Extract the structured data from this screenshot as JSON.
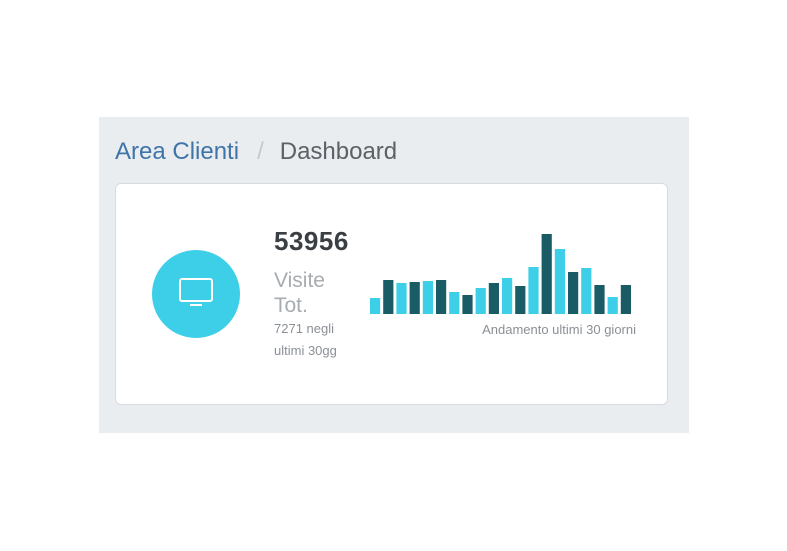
{
  "breadcrumb": {
    "parent": "Area Clienti",
    "separator": "/",
    "current": "Dashboard"
  },
  "stat_card": {
    "icon": "monitor-icon",
    "value": "53956",
    "label": "Visite Tot.",
    "sub_label": "7271 negli ultimi 30gg",
    "chart_caption": "Andamento ultimi 30 giorni"
  },
  "colors": {
    "accent_light": "#3ecfe8",
    "accent_dark": "#1a5c66",
    "link": "#3f74a8",
    "panel_bg": "#e9edf0"
  },
  "chart_data": {
    "type": "bar",
    "title": "",
    "xlabel": "",
    "ylabel": "",
    "ylim": [
      0,
      80
    ],
    "grid": false,
    "values": [
      16,
      34,
      31,
      32,
      33,
      34,
      22,
      19,
      26,
      31,
      36,
      28,
      47,
      80,
      65,
      42,
      46,
      29,
      17,
      29
    ],
    "bar_styles": [
      "light",
      "dark",
      "light",
      "dark",
      "light",
      "dark",
      "light",
      "dark",
      "light",
      "dark",
      "light",
      "dark",
      "light",
      "dark",
      "light",
      "dark",
      "light",
      "dark",
      "light",
      "dark"
    ]
  }
}
